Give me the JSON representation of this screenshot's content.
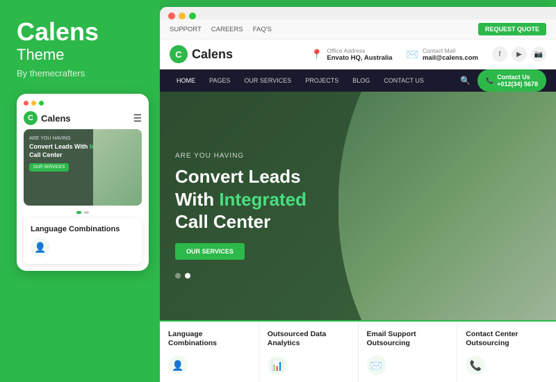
{
  "leftPanel": {
    "brandTitle": "Calens",
    "brandSubtitle": "Theme",
    "brandBy": "By themecrafters",
    "mobileMockup": {
      "logoText": "Calens",
      "heroTag": "ARE YOU HAVING",
      "heroTitle": "Convert Leads With ",
      "heroTitleGreen": "Integrated",
      "heroTitle2": "Call Center",
      "heroBtnLabel": "OUR SERVICES",
      "cardTitle": "Language Combinations",
      "cardIcon": "👤"
    }
  },
  "rightPanel": {
    "topbar": {
      "links": [
        "SUPPORT",
        "CAREERS",
        "FAQ'S"
      ],
      "ctaButton": "REQUEST QUOTE"
    },
    "header": {
      "logoText": "Calens",
      "officeLabel": "Office Address",
      "officeValue": "Envato HQ, Australia",
      "contactLabel": "Contact Mail",
      "contactValue": "mail@calens.com"
    },
    "nav": {
      "links": [
        "HOME",
        "PAGES",
        "OUR SERVICES",
        "PROJECTS",
        "BLOG",
        "CONTACT US"
      ],
      "contactBtn": "Contact Us",
      "contactPhone": "+012(34) 5678"
    },
    "hero": {
      "tag": "ARE YOU HAVING",
      "titleLine1": "Convert Leads",
      "titleLine2": "With ",
      "titleGreen": "Integrated",
      "titleLine3": "Call Center",
      "btnLabel": "OUR SERVICES"
    },
    "serviceCards": [
      {
        "title": "Language Combinations",
        "icon": "👤"
      },
      {
        "title": "Outsourced Data Analytics",
        "icon": "📊"
      },
      {
        "title": "Email Support Outsourcing",
        "icon": "✉️"
      },
      {
        "title": "Contact Center Outsourcing",
        "icon": "📞"
      }
    ]
  }
}
